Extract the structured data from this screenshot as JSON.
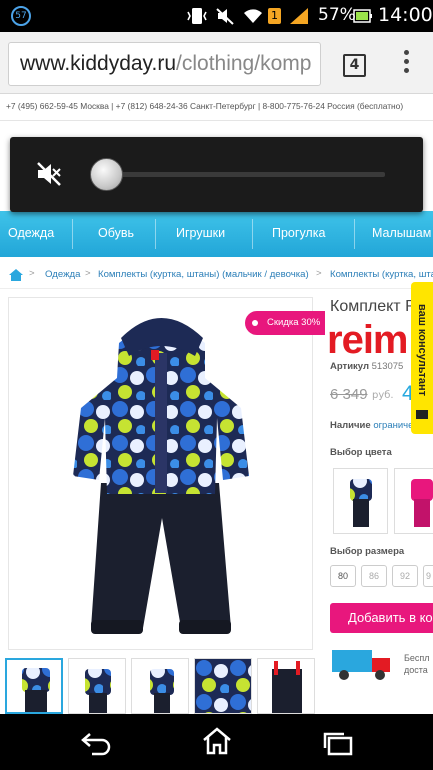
{
  "status_bar": {
    "notification_badge": "57",
    "battery_percent": "57%",
    "time": "14:00",
    "icons": [
      "notification-57-icon",
      "vibrate-icon",
      "mute-icon",
      "wifi-icon",
      "notification-1-icon",
      "signal-icon",
      "battery-icon"
    ]
  },
  "browser": {
    "url_host": "www.kiddyday.ru",
    "url_path": "/clothing/komp",
    "tab_count": "4"
  },
  "volume_overlay": {
    "icon": "muted-speaker-icon",
    "level": 0
  },
  "header": {
    "contacts": "+7 (495) 662-59-45 Москва | +7 (812) 648-24-36 Санкт-Петербург | 8-800-775-76-24 Россия (бесплатно)"
  },
  "nav": {
    "items": [
      "Одежда",
      "Обувь",
      "Игрушки",
      "Прогулка",
      "Малышам"
    ]
  },
  "breadcrumb": {
    "items": [
      "Одежда",
      "Комплекты (куртка, штаны) (мальчик / девочка)",
      "Комплекты (куртка, шта"
    ]
  },
  "product": {
    "title": "Комплект R",
    "brand": "reim",
    "sku_label": "Артикул",
    "sku_value": "513075",
    "old_price": "6 349",
    "old_currency": "руб.",
    "new_price": "4",
    "availability_label": "Наличие",
    "availability_value": "ограничен",
    "discount_badge": "Скидка 30%",
    "color_label": "Выбор цвета",
    "size_label": "Выбор размера",
    "sizes": [
      "80",
      "86",
      "92",
      "9"
    ],
    "add_to_cart": "Добавить в ко",
    "delivery_line1": "Беспл",
    "delivery_line2": "доста",
    "colors": {
      "accent_pink": "#e8177d",
      "accent_blue": "#27a9df",
      "brand_red": "#e31b23",
      "consult_yellow": "#ffe500"
    }
  },
  "consultant": {
    "label": "ваш консультант"
  }
}
